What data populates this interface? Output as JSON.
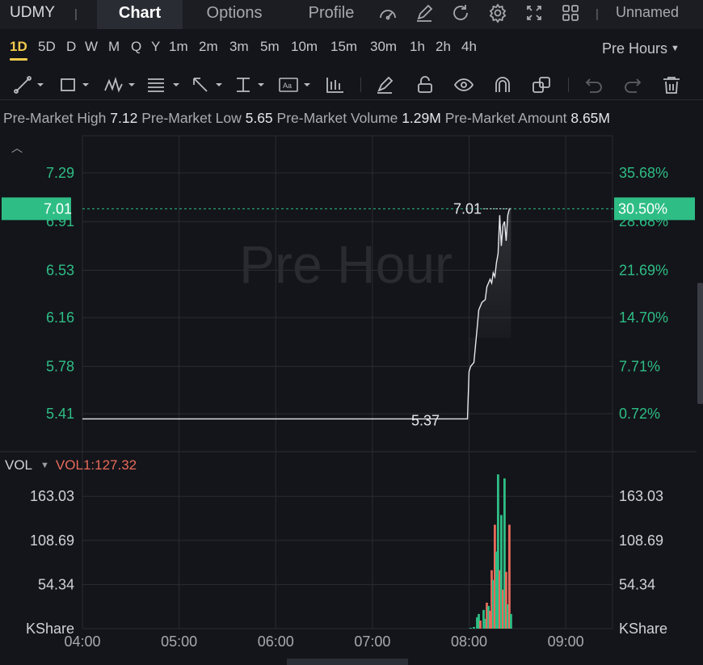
{
  "header": {
    "ticker": "UDMY",
    "tabs": [
      {
        "label": "Chart",
        "active": true
      },
      {
        "label": "Options",
        "active": false
      },
      {
        "label": "Profile",
        "active": false
      }
    ],
    "layout_name": "Unnamed",
    "icons": [
      "gauge-icon",
      "edit-icon",
      "refresh-icon",
      "settings-icon",
      "fullscreen-icon",
      "grid-icon"
    ]
  },
  "timeframes": {
    "items": [
      "1D",
      "5D",
      "D",
      "W",
      "M",
      "Q",
      "Y",
      "1m",
      "2m",
      "3m",
      "5m",
      "10m",
      "15m",
      "30m",
      "1h",
      "2h",
      "4h"
    ],
    "active": "1D",
    "session": "Pre Hours"
  },
  "toolbar": {
    "tools": [
      "trendline-icon",
      "rectangle-icon",
      "pattern-icon",
      "fib-icon",
      "arrow-icon",
      "measure-icon",
      "text-icon",
      "indicator-icon",
      "brush-icon",
      "lock-icon",
      "eye-icon",
      "magnet-icon",
      "clone-icon",
      "undo-icon",
      "redo-icon",
      "delete-icon"
    ]
  },
  "premarket": {
    "high_label": "Pre-Market High",
    "high": "7.12",
    "low_label": "Pre-Market Low",
    "low": "5.65",
    "volume_label": "Pre-Market Volume",
    "volume": "1.29M",
    "amount_label": "Pre-Market Amount",
    "amount": "8.65M"
  },
  "watermark": "Pre Hour",
  "colors": {
    "up": "#2ebd85",
    "down": "#e86a5a",
    "current": "#2ebd85",
    "background": "#14151a",
    "active_timeframe": "#f2c94c"
  },
  "chart_data": [
    {
      "type": "line",
      "x_ticks": [
        "04:00",
        "05:00",
        "06:00",
        "07:00",
        "08:00",
        "09:00"
      ],
      "y_left_ticks": [
        "7.29",
        "6.91",
        "6.53",
        "6.16",
        "5.78",
        "5.41"
      ],
      "y_right_ticks": [
        "35.68%",
        "28.68%",
        "21.69%",
        "14.70%",
        "7.71%",
        "0.72%"
      ],
      "current_price": "7.01",
      "current_pct": "30.50%",
      "annotations": {
        "high_label": "7.01",
        "low_label": "5.37"
      },
      "x_range": [
        "04:00",
        "09:29"
      ],
      "y_range": [
        5.12,
        7.58
      ],
      "series": [
        {
          "x": [
            "04:00",
            "04:30",
            "05:00",
            "05:30",
            "06:00",
            "06:30",
            "07:00",
            "07:30",
            "07:59",
            "08:00",
            "08:01",
            "08:03",
            "08:05",
            "08:06",
            "08:08",
            "08:10",
            "08:11",
            "08:13",
            "08:14",
            "08:15",
            "08:16",
            "08:17",
            "08:18",
            "08:19",
            "08:20",
            "08:21",
            "08:22",
            "08:23",
            "08:24",
            "08:25",
            "08:26"
          ],
          "values": [
            5.37,
            5.37,
            5.37,
            5.37,
            5.37,
            5.37,
            5.37,
            5.37,
            5.37,
            5.74,
            5.78,
            5.81,
            6.08,
            6.22,
            6.28,
            6.3,
            6.4,
            6.46,
            6.43,
            6.51,
            6.48,
            6.59,
            6.66,
            6.96,
            6.72,
            6.88,
            6.91,
            6.76,
            6.96,
            7.01,
            7.01
          ]
        }
      ]
    },
    {
      "type": "bar",
      "name": "VOL",
      "indicator_label": "VOL1:127.32",
      "y_ticks": [
        "163.03",
        "108.69",
        "54.34"
      ],
      "y_unit": "KShare",
      "ylim": [
        0,
        217
      ],
      "x": [
        "08:01",
        "08:03",
        "08:05",
        "08:06",
        "08:07",
        "08:09",
        "08:10",
        "08:11",
        "08:12",
        "08:13",
        "08:14",
        "08:15",
        "08:16",
        "08:17",
        "08:18",
        "08:19",
        "08:20",
        "08:21",
        "08:22",
        "08:23",
        "08:24",
        "08:25",
        "08:26"
      ],
      "values": [
        1,
        2,
        14,
        18,
        10,
        23,
        12,
        32,
        28,
        22,
        72,
        60,
        128,
        95,
        190,
        72,
        140,
        48,
        185,
        70,
        30,
        128,
        18
      ],
      "up": [
        true,
        true,
        true,
        true,
        false,
        true,
        true,
        false,
        true,
        false,
        false,
        true,
        false,
        true,
        true,
        false,
        true,
        false,
        true,
        false,
        true,
        false,
        true
      ]
    }
  ]
}
